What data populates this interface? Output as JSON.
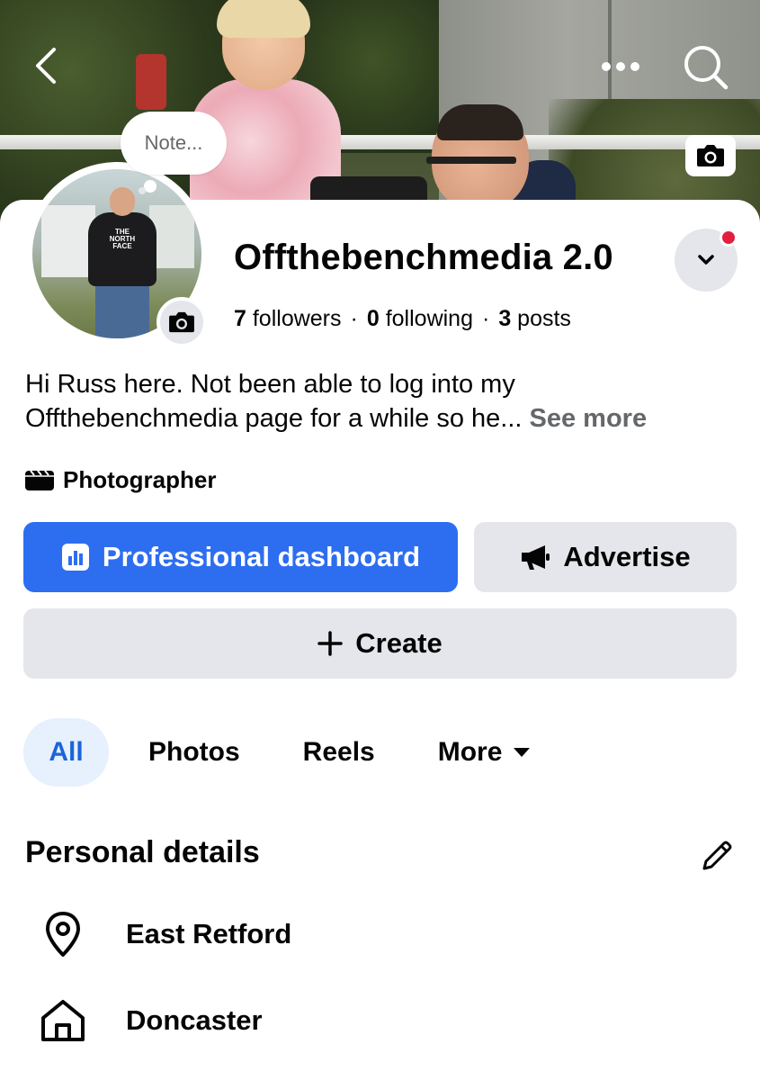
{
  "cover": {
    "note_placeholder": "Note..."
  },
  "profile": {
    "name": "Offthebenchmedia 2.0",
    "followers_count": "7",
    "followers_label": "followers",
    "following_count": "0",
    "following_label": "following",
    "posts_count": "3",
    "posts_label": "posts",
    "separator": "·",
    "bio_line1": "Hi Russ here. Not been able to log into my",
    "bio_line2": "Offthebenchmedia page for a while so he...",
    "see_more": "See more",
    "category": "Photographer",
    "avatar_shirt_text": "THE NORTH FACE"
  },
  "actions": {
    "dashboard_label": "Professional dashboard",
    "advertise_label": "Advertise",
    "create_label": "Create"
  },
  "tabs": [
    {
      "label": "All",
      "active": true
    },
    {
      "label": "Photos"
    },
    {
      "label": "Reels"
    },
    {
      "label": "More"
    }
  ],
  "personal_details": {
    "title": "Personal details",
    "items": [
      {
        "icon": "location-pin-icon",
        "label": "East Retford"
      },
      {
        "icon": "home-icon",
        "label": "Doncaster"
      }
    ]
  },
  "colors": {
    "primary_blue": "#2d6ef0",
    "tab_active_bg": "#e7f0fd",
    "tab_active_text": "#1b64d8",
    "secondary_bg": "#e4e6eb",
    "notification_red": "#e41e3f",
    "muted_text": "#65676b"
  }
}
